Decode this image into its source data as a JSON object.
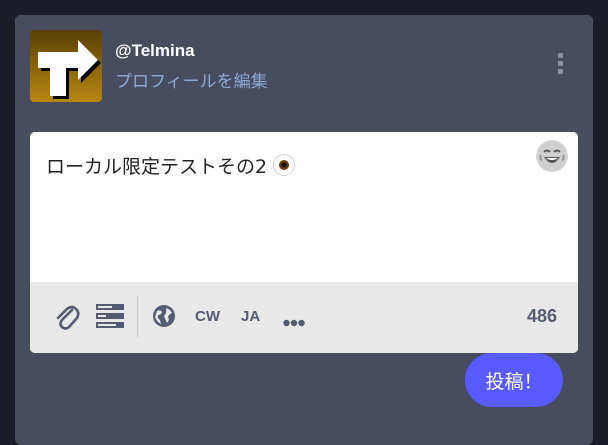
{
  "header": {
    "username": "@Telmina",
    "edit_profile": "プロフィールを編集"
  },
  "compose": {
    "text": "ローカル限定テストその2",
    "emoji_picker_icon": "laughing-face-icon"
  },
  "toolbar": {
    "attach_icon": "paperclip-icon",
    "poll_icon": "poll-icon",
    "visibility_icon": "globe-icon",
    "cw_label": "CW",
    "language_label": "JA",
    "more_icon": "more-icon",
    "char_count": "486"
  },
  "actions": {
    "post_label": "投稿！"
  },
  "colors": {
    "background": "#1b1d26",
    "panel": "#474c5e",
    "link": "#8da9d8",
    "accent": "#595aff",
    "toolbar_text": "#555b70"
  }
}
